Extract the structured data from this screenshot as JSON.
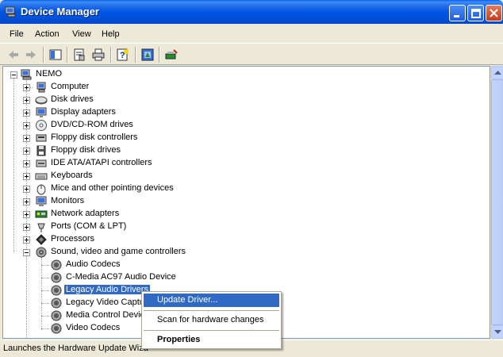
{
  "window": {
    "title": "Device Manager",
    "icon": "device-manager-icon"
  },
  "menu": [
    "File",
    "Action",
    "View",
    "Help"
  ],
  "toolbar": [
    "back-arrow-icon",
    "forward-arrow-icon",
    "show-hide-tree-icon",
    "properties-icon",
    "print-icon",
    "help-icon",
    "update-driver-icon",
    "scan-hardware-icon"
  ],
  "tree": {
    "root": "NEMO",
    "categories": [
      {
        "label": "Computer",
        "icon": "computer-icon"
      },
      {
        "label": "Disk drives",
        "icon": "disk-drive-icon"
      },
      {
        "label": "Display adapters",
        "icon": "display-adapter-icon"
      },
      {
        "label": "DVD/CD-ROM drives",
        "icon": "cdrom-icon"
      },
      {
        "label": "Floppy disk controllers",
        "icon": "floppy-controller-icon"
      },
      {
        "label": "Floppy disk drives",
        "icon": "floppy-drive-icon"
      },
      {
        "label": "IDE ATA/ATAPI controllers",
        "icon": "ide-controller-icon"
      },
      {
        "label": "Keyboards",
        "icon": "keyboard-icon"
      },
      {
        "label": "Mice and other pointing devices",
        "icon": "mouse-icon"
      },
      {
        "label": "Monitors",
        "icon": "monitor-icon"
      },
      {
        "label": "Network adapters",
        "icon": "network-adapter-icon"
      },
      {
        "label": "Ports (COM & LPT)",
        "icon": "port-icon"
      },
      {
        "label": "Processors",
        "icon": "processor-icon"
      },
      {
        "label": "Sound, video and game controllers",
        "icon": "speaker-icon"
      }
    ],
    "sound_children": [
      "Audio Codecs",
      "C-Media AC97 Audio Device",
      "Legacy Audio Drivers",
      "Legacy Video Captu",
      "Media Control Devic",
      "Video Codecs"
    ],
    "selected_child": "Legacy Audio Drivers"
  },
  "context_menu": {
    "update_driver": "Update Driver...",
    "scan": "Scan for hardware changes",
    "properties": "Properties"
  },
  "status": "Launches the Hardware Update Wiza",
  "colors": {
    "selection": "#316ac5",
    "titlebar": "#0055e4"
  }
}
